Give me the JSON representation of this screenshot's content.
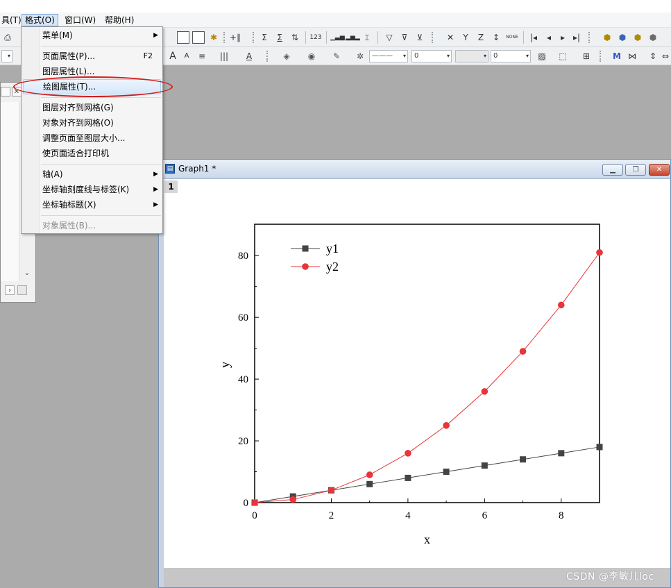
{
  "menubar": {
    "items": [
      {
        "label": "具(T)"
      },
      {
        "label": "格式(O)"
      },
      {
        "label": "窗口(W)"
      },
      {
        "label": "帮助(H)"
      }
    ]
  },
  "toolbar1": {
    "glyphs": [
      "⎙",
      "Σ",
      "Σ",
      "⇅",
      "123",
      "▁▃▅",
      "▂▅▂",
      "⌶",
      "⚑",
      "⚑",
      "⚑",
      "✕",
      "Y",
      "Z",
      "↕",
      "NONE",
      "|◂",
      "◂",
      "▸",
      "▸|",
      "⬢",
      "⬢",
      "⬢",
      "⬢"
    ]
  },
  "toolbar2": {
    "font_buttons": [
      "A",
      "A",
      "≡",
      "|||",
      "A"
    ],
    "line_style": "———",
    "line_width": "0",
    "pattern_width": "0"
  },
  "format_menu": {
    "items": [
      {
        "label": "菜单(M)",
        "submenu": true
      },
      {
        "label": "页面属性(P)...",
        "shortcut": "F2"
      },
      {
        "label": "图层属性(L)..."
      },
      {
        "label": "绘图属性(T)...",
        "highlighted": true
      },
      {
        "label": "图层对齐到网格(G)"
      },
      {
        "label": "对象对齐到网格(O)"
      },
      {
        "label": "调整页面至图层大小..."
      },
      {
        "label": "使页面适合打印机"
      },
      {
        "label": "轴(A)",
        "submenu": true
      },
      {
        "label": "坐标轴刻度线与标签(K)",
        "submenu": true
      },
      {
        "label": "坐标轴标题(X)",
        "submenu": true
      },
      {
        "label": "对象属性(B)...",
        "disabled": true
      }
    ]
  },
  "graph_window": {
    "title": "Graph1 *",
    "layer_number": "1"
  },
  "chart_data": {
    "type": "line",
    "x": [
      0,
      1,
      2,
      3,
      4,
      5,
      6,
      7,
      8,
      9
    ],
    "series": [
      {
        "name": "y1",
        "marker": "square",
        "color": "#444444",
        "values": [
          0,
          2,
          4,
          6,
          8,
          10,
          12,
          14,
          16,
          18
        ]
      },
      {
        "name": "y2",
        "marker": "circle",
        "color": "#e8343a",
        "values": [
          0,
          1,
          4,
          9,
          16,
          25,
          36,
          49,
          64,
          81
        ]
      }
    ],
    "xlabel": "x",
    "ylabel": "y",
    "xlim": [
      0,
      9
    ],
    "ylim": [
      0,
      80
    ],
    "xticks": [
      0,
      2,
      4,
      6,
      8
    ],
    "yticks": [
      0,
      20,
      40,
      60,
      80
    ],
    "legend_position": "top-left",
    "grid": false
  },
  "watermark": "CSDN @李敏儿loc"
}
